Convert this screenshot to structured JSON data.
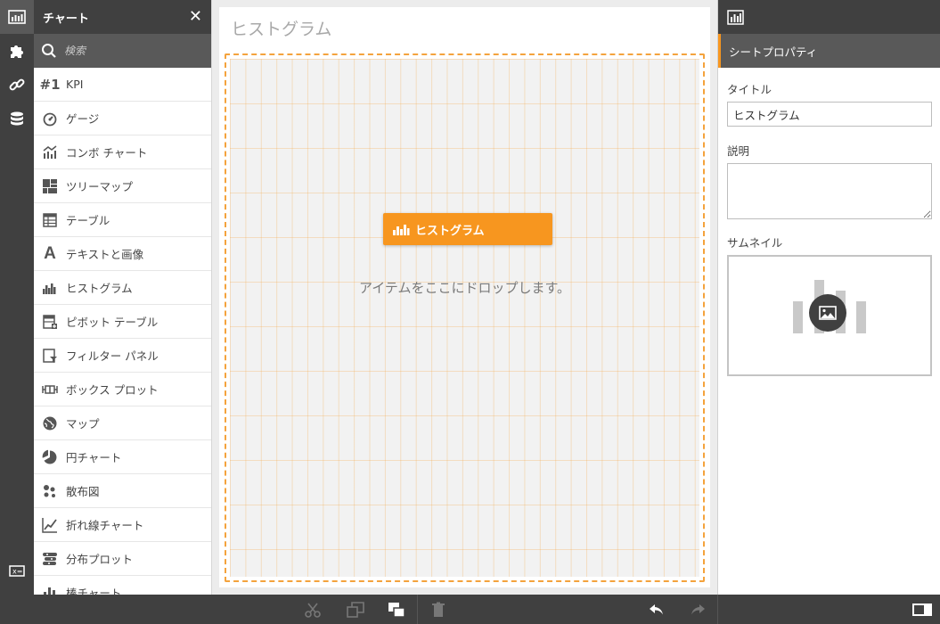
{
  "rail": {
    "items": [
      {
        "name": "charts-icon",
        "active": true
      },
      {
        "name": "extensions-icon",
        "active": false
      },
      {
        "name": "link-icon",
        "active": false
      },
      {
        "name": "database-icon",
        "active": false
      }
    ],
    "bottom": {
      "name": "variables-icon"
    }
  },
  "library": {
    "title": "チャート",
    "search_placeholder": "検索",
    "items": [
      {
        "label": "KPI",
        "icon": "kpi-icon"
      },
      {
        "label": "ゲージ",
        "icon": "gauge-icon"
      },
      {
        "label": "コンボ チャート",
        "icon": "combo-chart-icon"
      },
      {
        "label": "ツリーマップ",
        "icon": "treemap-icon"
      },
      {
        "label": "テーブル",
        "icon": "table-icon"
      },
      {
        "label": "テキストと画像",
        "icon": "text-image-icon"
      },
      {
        "label": "ヒストグラム",
        "icon": "histogram-icon"
      },
      {
        "label": "ピボット テーブル",
        "icon": "pivot-table-icon"
      },
      {
        "label": "フィルター パネル",
        "icon": "filter-pane-icon"
      },
      {
        "label": "ボックス プロット",
        "icon": "box-plot-icon"
      },
      {
        "label": "マップ",
        "icon": "map-icon"
      },
      {
        "label": "円チャート",
        "icon": "pie-chart-icon"
      },
      {
        "label": "散布図",
        "icon": "scatter-plot-icon"
      },
      {
        "label": "折れ線チャート",
        "icon": "line-chart-icon"
      },
      {
        "label": "分布プロット",
        "icon": "distribution-plot-icon"
      },
      {
        "label": "棒チャート",
        "icon": "bar-chart-icon"
      }
    ]
  },
  "sheet": {
    "title": "ヒストグラム",
    "drag_chip_label": "ヒストグラム",
    "drop_hint": "アイテムをここにドロップします。"
  },
  "properties": {
    "section_title": "シートプロパティ",
    "title_label": "タイトル",
    "title_value": "ヒストグラム",
    "description_label": "説明",
    "description_value": "",
    "thumbnail_label": "サムネイル"
  },
  "colors": {
    "accent": "#f7961f",
    "dark": "#404040",
    "mid": "#595959"
  }
}
